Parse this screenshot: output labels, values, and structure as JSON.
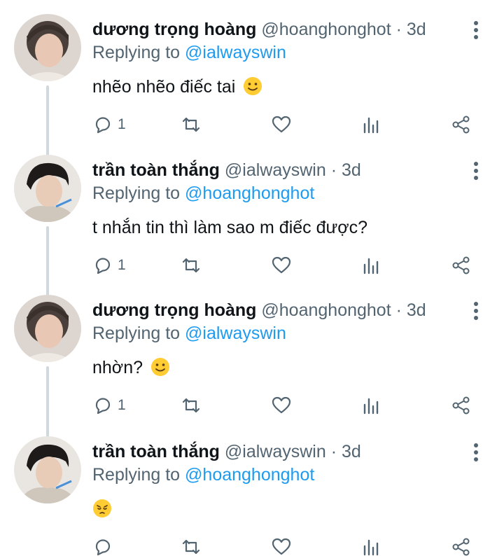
{
  "tweets": [
    {
      "name": "dương trọng hoàng",
      "handle": "@hoanghonghot",
      "separator": "·",
      "time": "3d",
      "replying_prefix": "Replying to",
      "replying_to": "@ialwayswin",
      "text": "nhẽo nhẽo điếc tai",
      "emoji": "slightly-smiling-face",
      "reply_count": "1",
      "avatar": "avatar-hoang"
    },
    {
      "name": "trần toàn thắng",
      "handle": "@ialwayswin",
      "separator": "·",
      "time": "3d",
      "replying_prefix": "Replying to",
      "replying_to": "@hoanghonghot",
      "text": "t nhắn tin thì làm sao m điếc được?",
      "emoji": "",
      "reply_count": "1",
      "avatar": "avatar-thang"
    },
    {
      "name": "dương trọng hoàng",
      "handle": "@hoanghonghot",
      "separator": "·",
      "time": "3d",
      "replying_prefix": "Replying to",
      "replying_to": "@ialwayswin",
      "text": "nhờn?",
      "emoji": "slightly-smiling-face",
      "reply_count": "1",
      "avatar": "avatar-hoang"
    },
    {
      "name": "trần toàn thắng",
      "handle": "@ialwayswin",
      "separator": "·",
      "time": "3d",
      "replying_prefix": "Replying to",
      "replying_to": "@hoanghonghot",
      "text": "",
      "emoji": "pensive-face",
      "reply_count": "",
      "avatar": "avatar-thang"
    }
  ],
  "colors": {
    "text": "#0f1419",
    "muted": "#536471",
    "link": "#1d9bf0",
    "thread_line": "#cfd9de",
    "emoji_yellow": "#ffcc33"
  },
  "icons": {
    "reply": "reply-icon",
    "retweet": "retweet-icon",
    "like": "heart-icon",
    "analytics": "analytics-icon",
    "share": "share-icon",
    "more": "more-vertical-icon"
  }
}
